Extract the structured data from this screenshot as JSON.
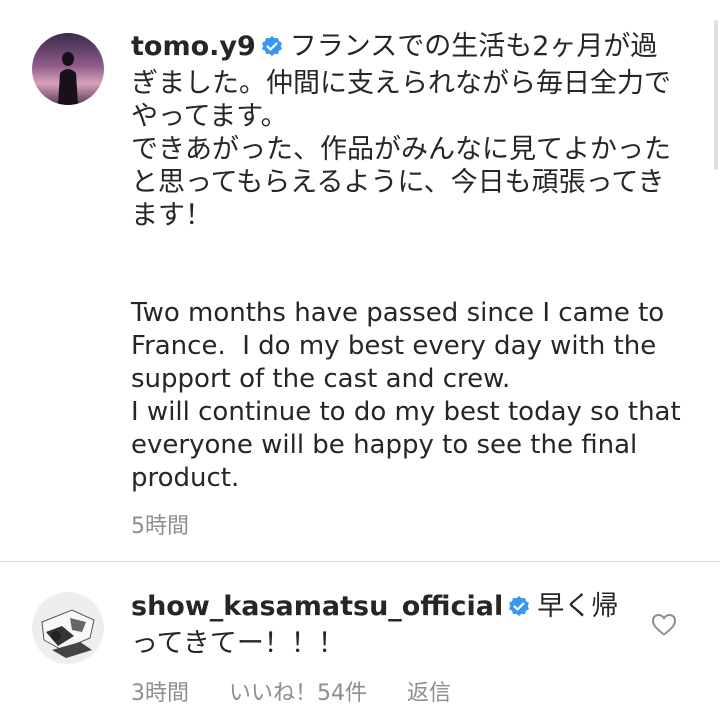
{
  "post": {
    "username": "tomo.y9",
    "text_ja": "フランスでの生活も2ヶ月が過ぎました。仲間に支えられながら毎日全力でやってます。\nできあがった、作品がみんなに見てよかったと思ってもらえるように、今日も頑張ってきます！",
    "text_en": "Two months have passed since I came to France.  I do my best every day with the support of the cast and crew.\nI will continue to do my best today so that everyone will be happy to see the final product.",
    "time": "5時間"
  },
  "reply": {
    "username": "show_kasamatsu_official",
    "text": "早く帰ってきてー！！！",
    "time": "3時間",
    "likes": "いいね！54件",
    "reply_label": "返信"
  },
  "colors": {
    "verified": "#3897f0",
    "meta": "#8e8e8e",
    "text": "#262626"
  }
}
